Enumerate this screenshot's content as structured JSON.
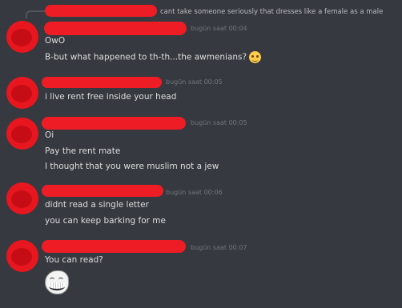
{
  "reply": {
    "text": "cant take someone seriously that dresses like a female as a male"
  },
  "messages": [
    {
      "timestamp": "bugün saat 00:04",
      "lines": [
        "OwO",
        "B-but what happened to th-th...the awmenians?"
      ],
      "emoji": "rolling-eyes-emoji"
    },
    {
      "timestamp": "bugün saat 00:05",
      "lines": [
        "i live rent free inside your head"
      ]
    },
    {
      "timestamp": "bugün saat 00:05",
      "lines": [
        "Oi",
        "Pay the rent mate",
        "I thought that you were muslim not a jew"
      ]
    },
    {
      "timestamp": "bugün saat 00:06",
      "lines": [
        "didnt read a single letter",
        "you can keep barking for me"
      ]
    },
    {
      "timestamp": "bugün saat 00:07",
      "lines": [
        "You can read?"
      ],
      "attachment": "trollface-emoji"
    }
  ],
  "colors": {
    "background": "#36393f",
    "redaction": "#ee1c25",
    "text": "#dcddde",
    "timestamp": "#72767d"
  }
}
